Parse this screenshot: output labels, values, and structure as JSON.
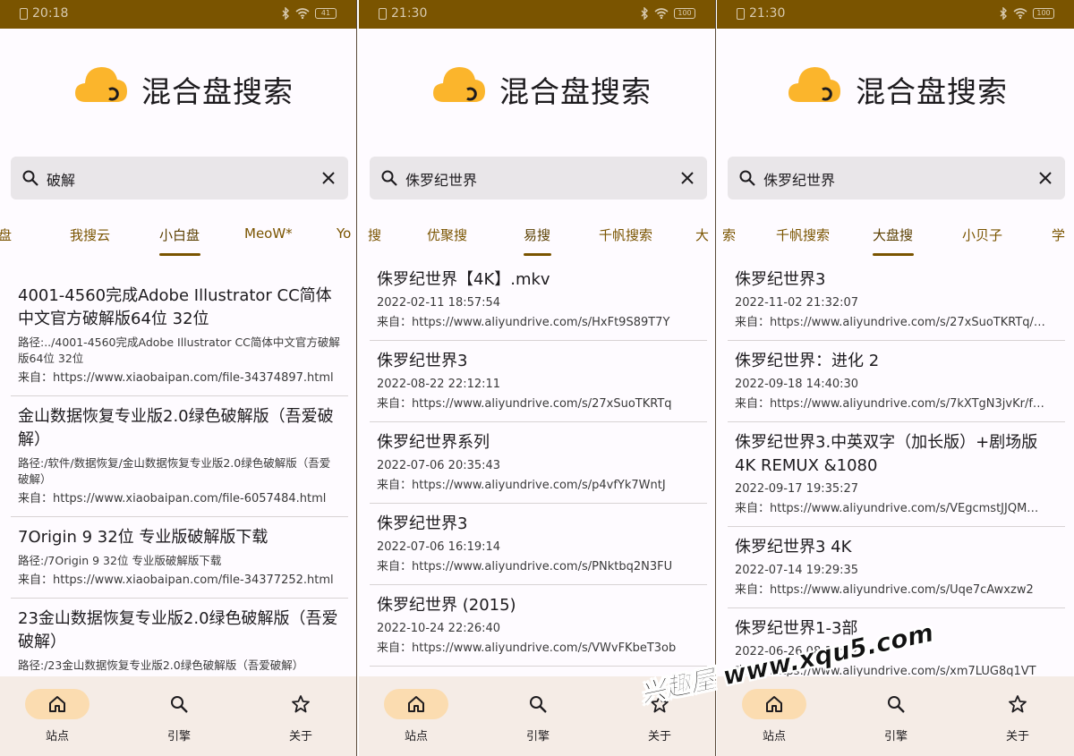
{
  "screens": [
    {
      "status": {
        "time": "20:18",
        "battery": "41"
      },
      "app_title": "混合盘搜索",
      "search": {
        "value": "破解",
        "placeholder": ""
      },
      "tabs": [
        "盘",
        "我搜云",
        "小白盘",
        "MeoW*",
        "Yo"
      ],
      "active_tab": "小白盘",
      "results": [
        {
          "title": "4001-4560完成Adobe Illustrator CC简体中文官方破解版64位 32位",
          "path": "路径:../4001-4560完成Adobe Illustrator CC简体中文官方破解版64位 32位",
          "src": "来自：https://www.xiaobaipan.com/file-34374897.html"
        },
        {
          "title": "金山数据恢复专业版2.0绿色破解版（吾爱破解）",
          "path": "路径:/软件/数据恢复/金山数据恢复专业版2.0绿色破解版（吾爱破解）",
          "src": "来自：https://www.xiaobaipan.com/file-6057484.html"
        },
        {
          "title": "7Origin 9 32位 专业版破解版下载",
          "path": "路径:/7Origin 9 32位 专业版破解版下载",
          "src": "来自：https://www.xiaobaipan.com/file-34377252.html"
        },
        {
          "title": "23金山数据恢复专业版2.0绿色破解版（吾爱破解）",
          "path": "路径:/23金山数据恢复专业版2.0绿色破解版（吾爱破解）",
          "src": ""
        }
      ],
      "nav": [
        "站点",
        "引擎",
        "关于"
      ],
      "active_nav": 0
    },
    {
      "status": {
        "time": "21:30",
        "battery": "100"
      },
      "app_title": "混合盘搜索",
      "search": {
        "value": "侏罗纪世界",
        "placeholder": ""
      },
      "tabs": [
        "搜",
        "优聚搜",
        "易搜",
        "千帆搜索",
        "大"
      ],
      "active_tab": "易搜",
      "results": [
        {
          "title": "侏罗纪世界【4K】.mkv",
          "date": "2022-02-11 18:57:54",
          "src": "来自：https://www.aliyundrive.com/s/HxFt9S89T7Y"
        },
        {
          "title": "侏罗纪世界3",
          "date": "2022-08-22 22:12:11",
          "src": "来自：https://www.aliyundrive.com/s/27xSuoTKRTq"
        },
        {
          "title": "侏罗纪世界系列",
          "date": "2022-07-06 20:35:43",
          "src": "来自：https://www.aliyundrive.com/s/p4vfYk7WntJ"
        },
        {
          "title": "侏罗纪世界3",
          "date": "2022-07-06 16:19:14",
          "src": "来自：https://www.aliyundrive.com/s/PNktbq2N3FU"
        },
        {
          "title": "侏罗纪世界 (2015)",
          "date": "2022-10-24 22:26:40",
          "src": "来自：https://www.aliyundrive.com/s/VWvFKbeT3ob"
        }
      ],
      "nav": [
        "站点",
        "引擎",
        "关于"
      ],
      "active_nav": 0
    },
    {
      "status": {
        "time": "21:30",
        "battery": "100"
      },
      "app_title": "混合盘搜索",
      "search": {
        "value": "侏罗纪世界",
        "placeholder": ""
      },
      "tabs": [
        "索",
        "千帆搜索",
        "大盘搜",
        "小贝子",
        "学"
      ],
      "active_tab": "大盘搜",
      "results": [
        {
          "title": "侏罗纪世界3",
          "date": "2022-11-02 21:32:07",
          "src": "来自：https://www.aliyundrive.com/s/27xSuoTKRTq/…"
        },
        {
          "title": "侏罗纪世界：进化 2",
          "date": "2022-09-18 14:40:30",
          "src": "来自：https://www.aliyundrive.com/s/7kXTgN3jvKr/f…"
        },
        {
          "title": "侏罗纪世界3.中英双字（加长版）+剧场版 4K REMUX &1080",
          "date": "2022-09-17 19:35:27",
          "src": "来自：https://www.aliyundrive.com/s/VEgcmstJJQM…"
        },
        {
          "title": "侏罗纪世界3 4K",
          "date": "2022-07-14 19:29:35",
          "src": "来自：https://www.aliyundrive.com/s/Uqe7cAwxzw2"
        },
        {
          "title": "侏罗纪世界1-3部",
          "date": "2022-06-26 08:10:22",
          "src": "来自：https://www.aliyundrive.com/s/xm7LUG8q1VT"
        }
      ],
      "nav": [
        "站点",
        "引擎",
        "关于"
      ],
      "active_nav": 0
    }
  ],
  "watermark": "兴趣屋 www.xqu5.com",
  "colors": {
    "status_bar": "#7a5400",
    "accent": "#7a5400",
    "logo": "#fbb52c",
    "nav_bg": "#f5ece6",
    "nav_active": "#fbdcb0"
  }
}
